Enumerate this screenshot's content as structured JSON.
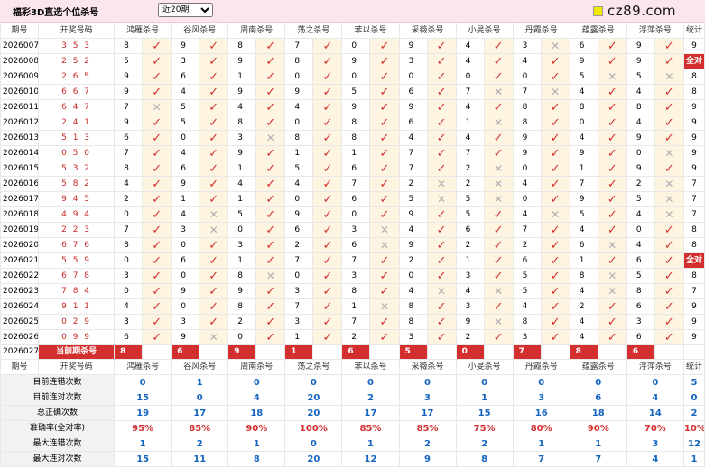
{
  "header": {
    "title": "福彩3D直选个位杀号",
    "period_select": "近20期",
    "logo_text": "cz89.com"
  },
  "columns": [
    "期号",
    "开奖号码",
    "鸿雁杀号",
    "谷风杀号",
    "周南杀号",
    "荡之杀号",
    "苯以杀号",
    "采薇杀号",
    "小旻杀号",
    "丹霞杀号",
    "蕴露杀号",
    "浮萍杀号",
    "统计"
  ],
  "rows": [
    {
      "p": "2026007",
      "d": "3 5 3",
      "k": [
        "8",
        "9",
        "8",
        "7",
        "0",
        "9",
        "4",
        "3",
        "6",
        "9"
      ],
      "r": [
        1,
        1,
        1,
        1,
        1,
        1,
        1,
        0,
        1,
        1
      ],
      "s": "9"
    },
    {
      "p": "2026008",
      "d": "2 5 2",
      "k": [
        "5",
        "3",
        "9",
        "8",
        "9",
        "3",
        "4",
        "4",
        "9",
        "9"
      ],
      "r": [
        1,
        1,
        1,
        1,
        1,
        1,
        1,
        1,
        1,
        1
      ],
      "s": "全对"
    },
    {
      "p": "2026009",
      "d": "2 6 5",
      "k": [
        "9",
        "6",
        "1",
        "0",
        "0",
        "0",
        "0",
        "0",
        "5",
        "5"
      ],
      "r": [
        1,
        1,
        1,
        1,
        1,
        1,
        1,
        1,
        0,
        0
      ],
      "s": "8"
    },
    {
      "p": "2026010",
      "d": "6 6 7",
      "k": [
        "9",
        "4",
        "9",
        "9",
        "5",
        "6",
        "7",
        "7",
        "4",
        "4"
      ],
      "r": [
        1,
        1,
        1,
        1,
        1,
        1,
        0,
        0,
        1,
        1
      ],
      "s": "8"
    },
    {
      "p": "2026011",
      "d": "6 4 7",
      "k": [
        "7",
        "5",
        "4",
        "4",
        "9",
        "9",
        "4",
        "8",
        "8",
        "8"
      ],
      "r": [
        0,
        1,
        1,
        1,
        1,
        1,
        1,
        1,
        1,
        1
      ],
      "s": "9"
    },
    {
      "p": "2026012",
      "d": "2 4 1",
      "k": [
        "9",
        "5",
        "8",
        "0",
        "8",
        "6",
        "1",
        "8",
        "0",
        "4"
      ],
      "r": [
        1,
        1,
        1,
        1,
        1,
        1,
        0,
        1,
        1,
        1
      ],
      "s": "9"
    },
    {
      "p": "2026013",
      "d": "5 1 3",
      "k": [
        "6",
        "0",
        "3",
        "8",
        "8",
        "4",
        "4",
        "9",
        "4",
        "9"
      ],
      "r": [
        1,
        1,
        0,
        1,
        1,
        1,
        1,
        1,
        1,
        1
      ],
      "s": "9"
    },
    {
      "p": "2026014",
      "d": "0 5 0",
      "k": [
        "7",
        "4",
        "9",
        "1",
        "1",
        "7",
        "7",
        "9",
        "9",
        "0"
      ],
      "r": [
        1,
        1,
        1,
        1,
        1,
        1,
        1,
        1,
        1,
        0
      ],
      "s": "9"
    },
    {
      "p": "2026015",
      "d": "5 3 2",
      "k": [
        "8",
        "6",
        "1",
        "5",
        "6",
        "7",
        "2",
        "0",
        "1",
        "9"
      ],
      "r": [
        1,
        1,
        1,
        1,
        1,
        1,
        0,
        1,
        1,
        1
      ],
      "s": "9"
    },
    {
      "p": "2026016",
      "d": "5 8 2",
      "k": [
        "4",
        "9",
        "4",
        "4",
        "7",
        "2",
        "2",
        "4",
        "7",
        "2"
      ],
      "r": [
        1,
        1,
        1,
        1,
        1,
        0,
        0,
        1,
        1,
        0
      ],
      "s": "7"
    },
    {
      "p": "2026017",
      "d": "9 4 5",
      "k": [
        "2",
        "1",
        "1",
        "0",
        "6",
        "5",
        "5",
        "0",
        "9",
        "5"
      ],
      "r": [
        1,
        1,
        1,
        1,
        1,
        0,
        0,
        1,
        1,
        0
      ],
      "s": "7"
    },
    {
      "p": "2026018",
      "d": "4 9 4",
      "k": [
        "0",
        "4",
        "5",
        "9",
        "0",
        "9",
        "5",
        "4",
        "5",
        "4"
      ],
      "r": [
        1,
        0,
        1,
        1,
        1,
        1,
        1,
        0,
        1,
        0
      ],
      "s": "7"
    },
    {
      "p": "2026019",
      "d": "2 2 3",
      "k": [
        "7",
        "3",
        "0",
        "6",
        "3",
        "4",
        "6",
        "7",
        "4",
        "0"
      ],
      "r": [
        1,
        0,
        1,
        1,
        0,
        1,
        1,
        1,
        1,
        1
      ],
      "s": "8"
    },
    {
      "p": "2026020",
      "d": "6 7 6",
      "k": [
        "8",
        "0",
        "3",
        "2",
        "6",
        "9",
        "2",
        "2",
        "6",
        "4"
      ],
      "r": [
        1,
        1,
        1,
        1,
        0,
        1,
        1,
        1,
        0,
        1
      ],
      "s": "8"
    },
    {
      "p": "2026021",
      "d": "5 5 9",
      "k": [
        "0",
        "6",
        "1",
        "7",
        "7",
        "2",
        "1",
        "6",
        "1",
        "6"
      ],
      "r": [
        1,
        1,
        1,
        1,
        1,
        1,
        1,
        1,
        1,
        1
      ],
      "s": "全对"
    },
    {
      "p": "2026022",
      "d": "6 7 8",
      "k": [
        "3",
        "0",
        "8",
        "0",
        "3",
        "0",
        "3",
        "5",
        "8",
        "5"
      ],
      "r": [
        1,
        1,
        0,
        1,
        1,
        1,
        1,
        1,
        0,
        1
      ],
      "s": "8"
    },
    {
      "p": "2026023",
      "d": "7 8 4",
      "k": [
        "0",
        "9",
        "9",
        "3",
        "8",
        "4",
        "4",
        "5",
        "4",
        "8"
      ],
      "r": [
        1,
        1,
        1,
        1,
        1,
        0,
        0,
        1,
        0,
        1
      ],
      "s": "7"
    },
    {
      "p": "2026024",
      "d": "9 1 1",
      "k": [
        "4",
        "0",
        "8",
        "7",
        "1",
        "8",
        "3",
        "4",
        "2",
        "6"
      ],
      "r": [
        1,
        1,
        1,
        1,
        0,
        1,
        1,
        1,
        1,
        1
      ],
      "s": "9"
    },
    {
      "p": "2026025",
      "d": "0 2 9",
      "k": [
        "3",
        "3",
        "2",
        "3",
        "7",
        "8",
        "9",
        "8",
        "4",
        "3"
      ],
      "r": [
        1,
        1,
        1,
        1,
        1,
        1,
        0,
        1,
        1,
        1
      ],
      "s": "9"
    },
    {
      "p": "2026026",
      "d": "0 9 9",
      "k": [
        "6",
        "9",
        "0",
        "1",
        "2",
        "3",
        "2",
        "3",
        "4",
        "6"
      ],
      "r": [
        1,
        0,
        1,
        1,
        1,
        1,
        1,
        1,
        1,
        1
      ],
      "s": "9"
    }
  ],
  "current": {
    "period": "2026027",
    "label": "当前期杀号",
    "kills": [
      "8",
      "6",
      "9",
      "1",
      "6",
      "5",
      "0",
      "7",
      "8",
      "6"
    ]
  },
  "stats": [
    {
      "label": "目前连错次数",
      "v": [
        "0",
        "1",
        "0",
        "0",
        "0",
        "0",
        "0",
        "0",
        "0",
        "0",
        "5"
      ]
    },
    {
      "label": "目前连对次数",
      "v": [
        "15",
        "0",
        "4",
        "20",
        "2",
        "3",
        "1",
        "3",
        "6",
        "4",
        "0"
      ]
    },
    {
      "label": "总正确次数",
      "v": [
        "19",
        "17",
        "18",
        "20",
        "17",
        "17",
        "15",
        "16",
        "18",
        "14",
        "2"
      ]
    },
    {
      "label": "准确率(全对率)",
      "v": [
        "95%",
        "85%",
        "90%",
        "100%",
        "85%",
        "85%",
        "75%",
        "80%",
        "90%",
        "70%",
        "10%"
      ],
      "rate": true
    },
    {
      "label": "最大连错次数",
      "v": [
        "1",
        "2",
        "1",
        "0",
        "1",
        "2",
        "2",
        "1",
        "1",
        "3",
        "12"
      ]
    },
    {
      "label": "最大连对次数",
      "v": [
        "15",
        "11",
        "8",
        "20",
        "12",
        "9",
        "8",
        "7",
        "7",
        "4",
        "1"
      ]
    }
  ],
  "glyphs": {
    "right": "✓",
    "wrong": "✕"
  },
  "colors": {
    "red": "#d32f2f",
    "blue": "#1565c0",
    "pink_bar": "#fce6ee"
  }
}
